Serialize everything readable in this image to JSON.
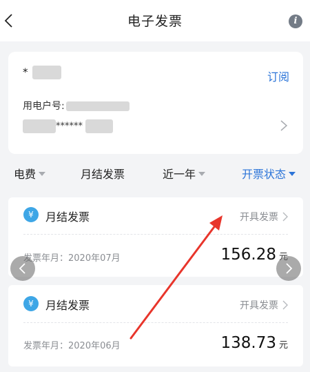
{
  "header": {
    "title": "电子发票"
  },
  "account": {
    "name_prefix": "*",
    "subscribe_label": "订阅",
    "user_no_label": "用电户号:",
    "account_mask": "******"
  },
  "filters": [
    {
      "label": "电费",
      "caret": true,
      "active": false
    },
    {
      "label": "月结发票",
      "caret": false,
      "active": false
    },
    {
      "label": "近一年",
      "caret": true,
      "active": false
    },
    {
      "label": "开票状态",
      "caret": true,
      "active": true
    }
  ],
  "invoices": [
    {
      "icon": "yen-icon",
      "icon_glyph": "¥",
      "label": "月结发票",
      "action": "开具发票",
      "date_label": "发票年月：",
      "date": "2020年07月",
      "amount": "156.28",
      "unit": "元"
    },
    {
      "icon": "yen-icon",
      "icon_glyph": "¥",
      "label": "月结发票",
      "action": "开具发票",
      "date_label": "发票年月：",
      "date": "2020年06月",
      "amount": "138.73",
      "unit": "元"
    }
  ],
  "colors": {
    "accent": "#2b74d8",
    "annotation": "#e8352b",
    "icon_bg": "#3ea6e6"
  }
}
